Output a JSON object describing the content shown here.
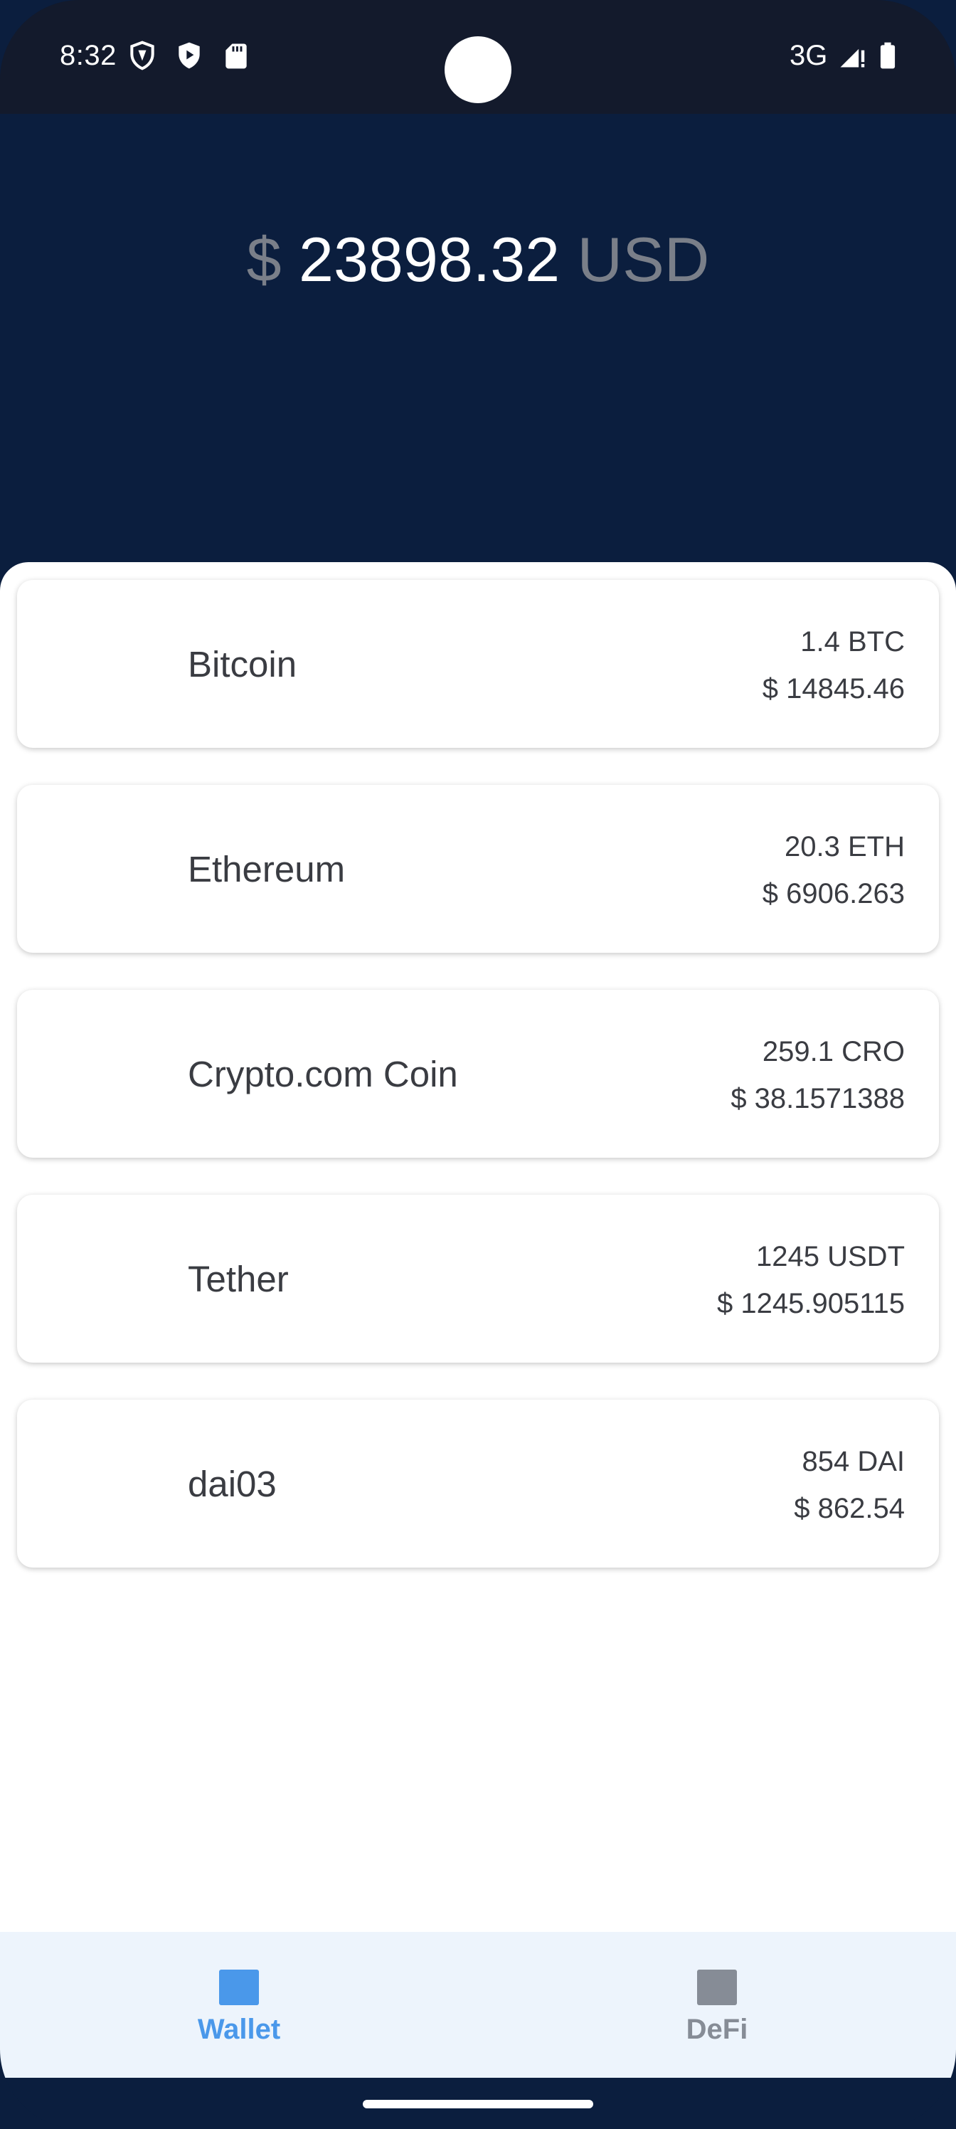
{
  "status_bar": {
    "time": "8:32",
    "network": "3G",
    "icons": [
      "vpn-shield-icon",
      "play-protect-icon",
      "sd-card-icon",
      "signal-icon",
      "battery-icon"
    ]
  },
  "header": {
    "currency_symbol": "$",
    "total": "23898.32",
    "currency_code": "USD"
  },
  "assets": [
    {
      "name": "Bitcoin",
      "quantity": "1.4 BTC",
      "value": "$ 14845.46"
    },
    {
      "name": "Ethereum",
      "quantity": "20.3 ETH",
      "value": "$ 6906.263"
    },
    {
      "name": "Crypto.com Coin",
      "quantity": "259.1 CRO",
      "value": "$ 38.1571388"
    },
    {
      "name": "Tether",
      "quantity": "1245 USDT",
      "value": "$ 1245.905115"
    },
    {
      "name": "dai03",
      "quantity": "854 DAI",
      "value": "$ 862.54"
    }
  ],
  "nav": {
    "items": [
      {
        "label": "Wallet",
        "icon": "wallet-icon",
        "active": true
      },
      {
        "label": "DeFi",
        "icon": "defi-icon",
        "active": false
      }
    ]
  },
  "colors": {
    "header_bg": "#0b1e3e",
    "status_bar_bg": "#131a2c",
    "nav_bg": "#edf4fc",
    "active": "#4a98ea",
    "inactive": "#868c96",
    "text": "#3a3c42"
  }
}
